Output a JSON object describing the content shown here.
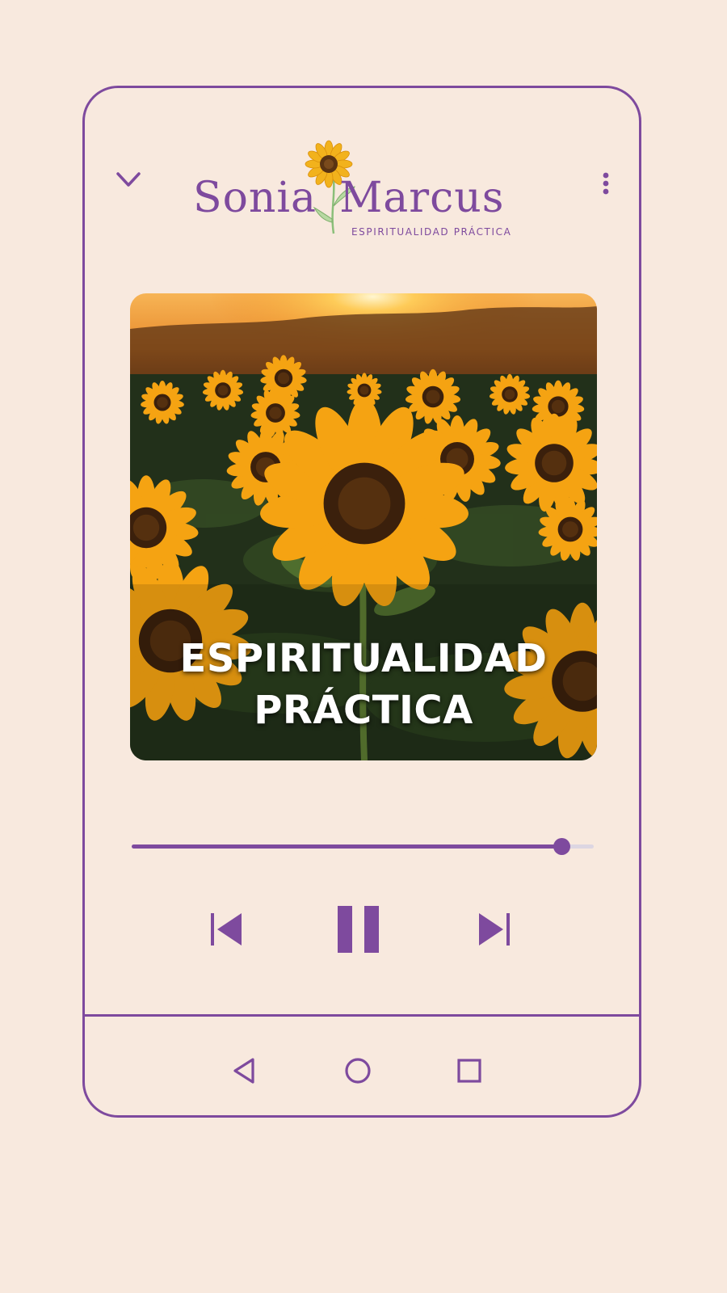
{
  "colors": {
    "background": "#f8e9de",
    "accent": "#7e4a9e",
    "progress_rail": "#ddd6e2"
  },
  "header": {
    "logo_first": "Sonia",
    "logo_last": "Marcus",
    "logo_tagline": "ESPIRITUALIDAD PRÁCTICA",
    "collapse_icon": "chevron-down-icon",
    "menu_icon": "more-vertical-icon"
  },
  "cover": {
    "title_line1": "ESPIRITUALIDAD",
    "title_line2": "PRÁCTICA"
  },
  "player": {
    "progress_fraction": 0.93,
    "prev_icon": "skip-previous-icon",
    "play_state_icon": "pause-icon",
    "next_icon": "skip-next-icon"
  },
  "navbar": {
    "back_icon": "triangle-back-icon",
    "home_icon": "circle-home-icon",
    "recents_icon": "square-recents-icon"
  }
}
